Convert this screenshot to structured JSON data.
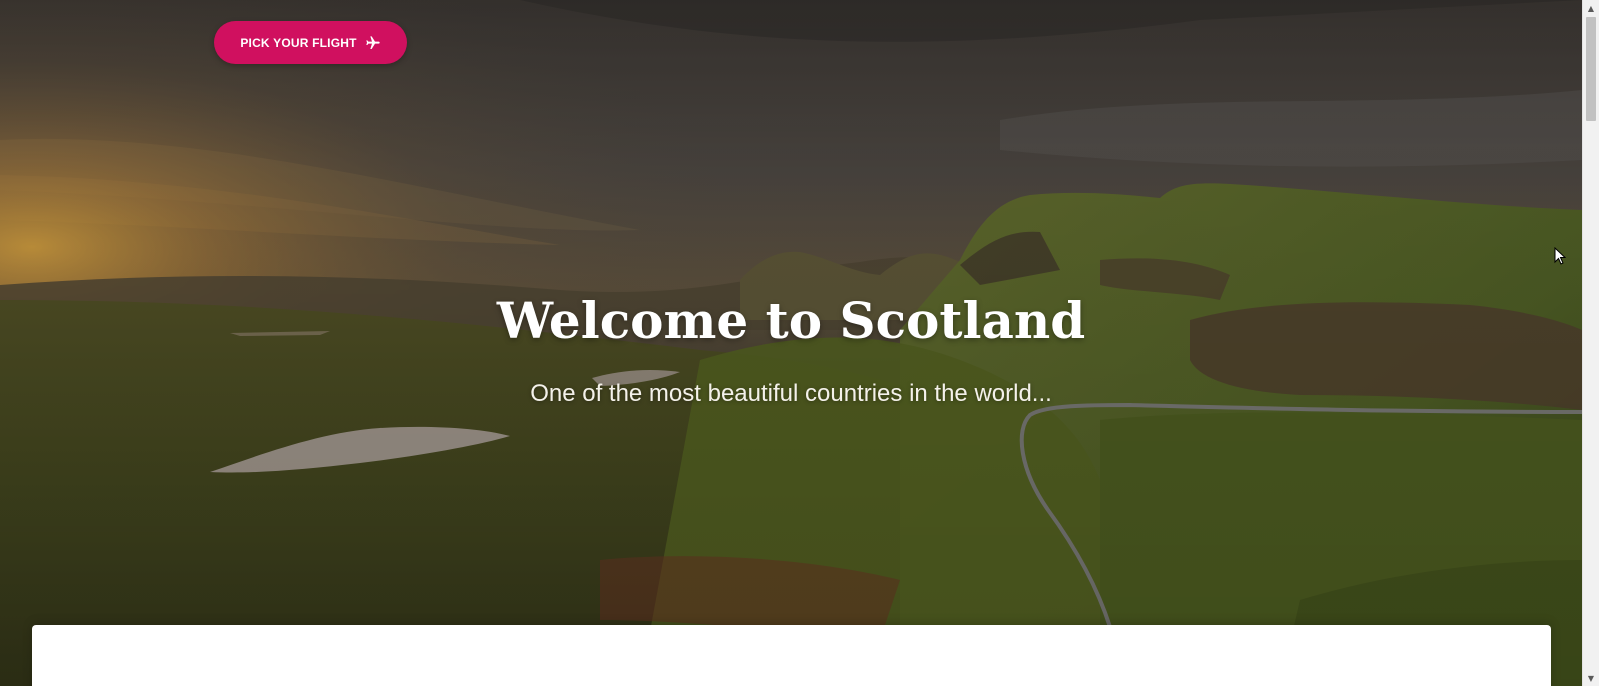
{
  "hero": {
    "cta_label": "PICK YOUR FLIGHT",
    "cta_icon": "airplane-icon",
    "title": "Welcome to Scotland",
    "subtitle": "One of the most beautiful countries in the world..."
  },
  "colors": {
    "accent": "#d0105f",
    "title_text": "#ffffff",
    "card_background": "#ffffff"
  }
}
